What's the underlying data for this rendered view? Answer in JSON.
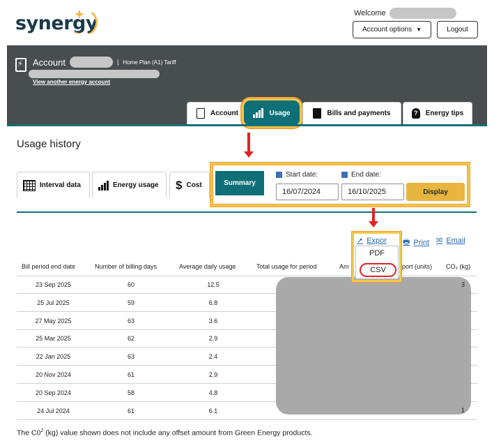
{
  "header": {
    "logo_text": "synergy",
    "welcome_label": "Welcome",
    "account_options_label": "Account options",
    "logout_label": "Logout"
  },
  "account": {
    "label": "Account",
    "plan": "Home Plan (A1) Tariff",
    "view_another": "View another energy account"
  },
  "tabs": [
    {
      "label": "Account",
      "icon": "account-doc-icon"
    },
    {
      "label": "Usage",
      "icon": "bar-chart-icon"
    },
    {
      "label": "Bills and payments",
      "icon": "bill-doc-icon"
    },
    {
      "label": "Energy tips",
      "icon": "lightbulb-icon"
    }
  ],
  "page_title": "Usage history",
  "sub_tabs": [
    {
      "label": "Interval data"
    },
    {
      "label": "Energy usage"
    },
    {
      "label": "Cost"
    },
    {
      "label": "Summary"
    }
  ],
  "date_filter": {
    "start_label": "Start date:",
    "start_value": "16/07/2024",
    "end_label": "End date:",
    "end_value": "16/10/2025",
    "display_label": "Display"
  },
  "actions": {
    "export_label": "Expor",
    "print_label": "Print",
    "email_label": "Email",
    "export_menu": [
      "PDF",
      "CSV"
    ]
  },
  "table": {
    "headers": [
      "Bill period end date",
      "Number of billing days",
      "Average daily usage",
      "Total usage for period",
      "Am",
      "port (units)",
      "CO₂ (kg)"
    ],
    "rows": [
      {
        "date": "23 Sep 2025",
        "days": "60",
        "avg": "12.5"
      },
      {
        "date": "25 Jul 2025",
        "days": "59",
        "avg": "6.8"
      },
      {
        "date": "27 May 2025",
        "days": "63",
        "avg": "3.6"
      },
      {
        "date": "25 Mar 2025",
        "days": "62",
        "avg": "2.9"
      },
      {
        "date": "22 Jan 2025",
        "days": "63",
        "avg": "2.4"
      },
      {
        "date": "20 Nov 2024",
        "days": "61",
        "avg": "2.9"
      },
      {
        "date": "20 Sep 2024",
        "days": "58",
        "avg": "4.8"
      },
      {
        "date": "24 Jul 2024",
        "days": "61",
        "avg": "6.1"
      }
    ],
    "edge_fragments": [
      "3",
      "1"
    ]
  },
  "footnote": {
    "pre": "The C0",
    "sup": "2",
    "post": " (kg) value shown does not include any offset amount from Green Energy products."
  },
  "colors": {
    "teal": "#0e6f77",
    "dark_band": "#484e4f",
    "display_button": "#e8b63f",
    "highlight": "#f1c84a",
    "arrow_red": "#e02424",
    "link_blue": "#2b6ab2"
  }
}
